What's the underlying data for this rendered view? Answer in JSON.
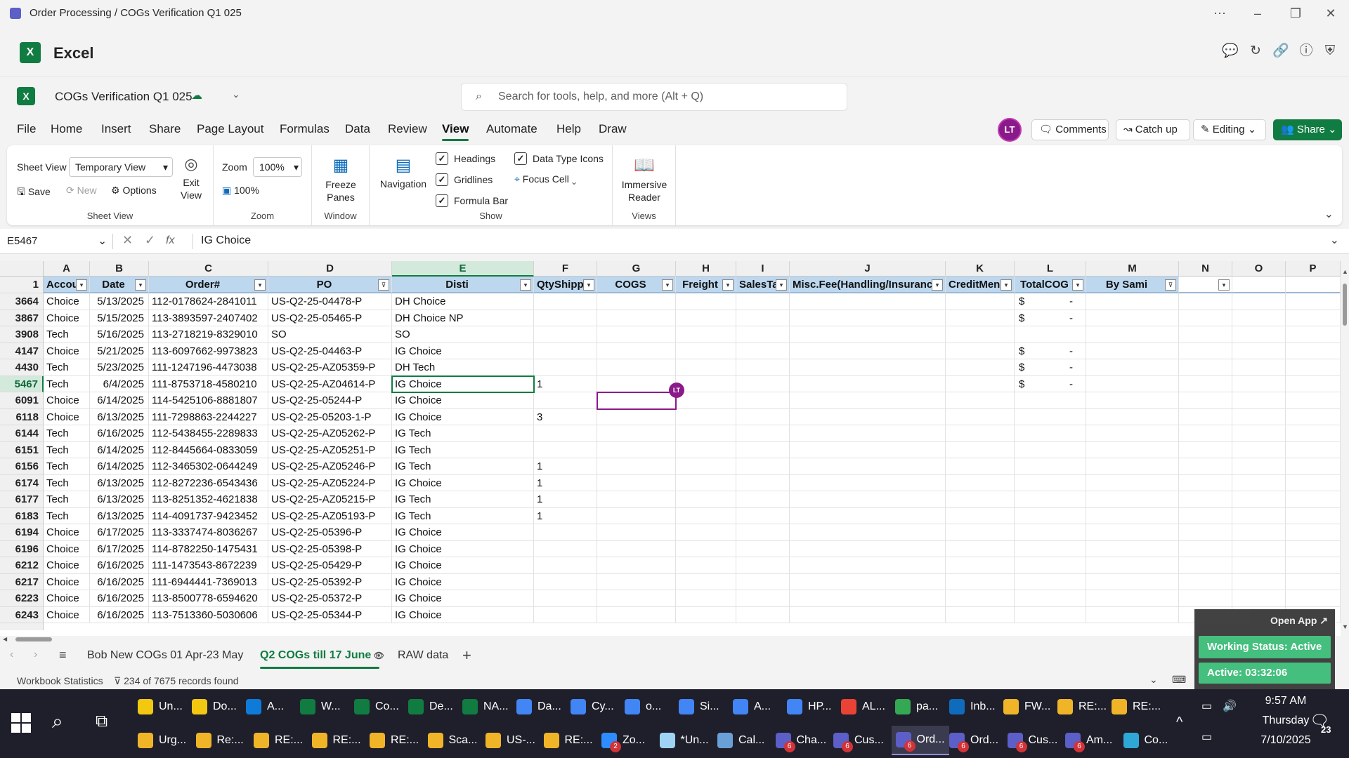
{
  "window": {
    "title": "Order Processing / COGs Verification Q1 025"
  },
  "app": {
    "name": "Excel"
  },
  "doc": {
    "name": "COGs Verification Q1 025"
  },
  "search": {
    "placeholder": "Search for tools, help, and more (Alt + Q)"
  },
  "menu": {
    "items": [
      "File",
      "Home",
      "Insert",
      "Share",
      "Page Layout",
      "Formulas",
      "Data",
      "Review",
      "View",
      "Automate",
      "Help",
      "Draw"
    ],
    "active": "View"
  },
  "user": {
    "initials": "LT"
  },
  "actions": {
    "comments": "Comments",
    "catchup": "Catch up",
    "editing": "Editing",
    "share": "Share"
  },
  "ribbon": {
    "sheet_view": {
      "label": "Sheet View",
      "selected": "Temporary View",
      "save": "Save",
      "new": "New",
      "options": "Options",
      "exit": "Exit View",
      "group": "Sheet View"
    },
    "zoom": {
      "label": "Zoom",
      "value": "100%",
      "hundred": "100%",
      "group": "Zoom"
    },
    "window": {
      "freeze": "Freeze Panes",
      "group": "Window"
    },
    "show": {
      "navigation": "Navigation",
      "headings": "Headings",
      "gridlines": "Gridlines",
      "formula_bar": "Formula Bar",
      "data_type_icons": "Data Type Icons",
      "focus_cell": "Focus Cell",
      "group": "Show"
    },
    "views": {
      "immersive": "Immersive Reader",
      "group": "Views"
    }
  },
  "formula": {
    "namebox": "E5467",
    "fx": "fx",
    "content": "IG Choice"
  },
  "grid": {
    "columns": [
      "A",
      "B",
      "C",
      "D",
      "E",
      "F",
      "G",
      "H",
      "I",
      "J",
      "K",
      "L",
      "M",
      "N",
      "O",
      "P"
    ],
    "selected_column": "E",
    "header_row_num": "1",
    "headers": [
      "Accou",
      "Date",
      "Order#",
      "PO",
      "Disti",
      "QtyShipp",
      "COGS",
      "Freight",
      "SalesTa",
      "Misc.Fee(Handling/Insuranc",
      "CreditMen",
      "TotalCOG",
      "By Sami",
      "",
      "",
      ""
    ],
    "rows": [
      {
        "num": "3664",
        "a": "Choice",
        "b": "5/13/2025",
        "c": "112-0178624-2841011",
        "d": "US-Q2-25-04478-P",
        "e": "DH Choice",
        "f": "",
        "l1": "$",
        "l2": "-"
      },
      {
        "num": "3867",
        "a": "Choice",
        "b": "5/15/2025",
        "c": "113-3893597-2407402",
        "d": "US-Q2-25-05465-P",
        "e": "DH Choice NP",
        "f": "",
        "l1": "$",
        "l2": "-"
      },
      {
        "num": "3908",
        "a": "Tech",
        "b": "5/16/2025",
        "c": "113-2718219-8329010",
        "d": "SO",
        "e": "SO",
        "f": "",
        "l1": "",
        "l2": ""
      },
      {
        "num": "4147",
        "a": "Choice",
        "b": "5/21/2025",
        "c": "113-6097662-9973823",
        "d": "US-Q2-25-04463-P",
        "e": "IG Choice",
        "f": "",
        "l1": "$",
        "l2": "-"
      },
      {
        "num": "4430",
        "a": "Tech",
        "b": "5/23/2025",
        "c": "111-1247196-4473038",
        "d": "US-Q2-25-AZ05359-P",
        "e": "DH Tech",
        "f": "",
        "l1": "$",
        "l2": "-"
      },
      {
        "num": "5467",
        "a": "Tech",
        "b": "6/4/2025",
        "c": "111-8753718-4580210",
        "d": "US-Q2-25-AZ04614-P",
        "e": "IG Choice",
        "f": "1",
        "l1": "$",
        "l2": "-"
      },
      {
        "num": "6091",
        "a": "Choice",
        "b": "6/14/2025",
        "c": "114-5425106-8881807",
        "d": "US-Q2-25-05244-P",
        "e": "IG Choice",
        "f": "",
        "l1": "",
        "l2": ""
      },
      {
        "num": "6118",
        "a": "Choice",
        "b": "6/13/2025",
        "c": "111-7298863-2244227",
        "d": "US-Q2-25-05203-1-P",
        "e": "IG Choice",
        "f": "3",
        "l1": "",
        "l2": ""
      },
      {
        "num": "6144",
        "a": "Tech",
        "b": "6/16/2025",
        "c": "112-5438455-2289833",
        "d": "US-Q2-25-AZ05262-P",
        "e": "IG Tech",
        "f": "",
        "l1": "",
        "l2": ""
      },
      {
        "num": "6151",
        "a": "Tech",
        "b": "6/14/2025",
        "c": "112-8445664-0833059",
        "d": "US-Q2-25-AZ05251-P",
        "e": "IG Tech",
        "f": "",
        "l1": "",
        "l2": ""
      },
      {
        "num": "6156",
        "a": "Tech",
        "b": "6/14/2025",
        "c": "112-3465302-0644249",
        "d": "US-Q2-25-AZ05246-P",
        "e": "IG Tech",
        "f": "1",
        "l1": "",
        "l2": ""
      },
      {
        "num": "6174",
        "a": "Tech",
        "b": "6/13/2025",
        "c": "112-8272236-6543436",
        "d": "US-Q2-25-AZ05224-P",
        "e": "IG Choice",
        "f": "1",
        "l1": "",
        "l2": ""
      },
      {
        "num": "6177",
        "a": "Tech",
        "b": "6/13/2025",
        "c": "113-8251352-4621838",
        "d": "US-Q2-25-AZ05215-P",
        "e": "IG Tech",
        "f": "1",
        "l1": "",
        "l2": ""
      },
      {
        "num": "6183",
        "a": "Tech",
        "b": "6/13/2025",
        "c": "114-4091737-9423452",
        "d": "US-Q2-25-AZ05193-P",
        "e": "IG Tech",
        "f": "1",
        "l1": "",
        "l2": ""
      },
      {
        "num": "6194",
        "a": "Choice",
        "b": "6/17/2025",
        "c": "113-3337474-8036267",
        "d": "US-Q2-25-05396-P",
        "e": "IG Choice",
        "f": "",
        "l1": "",
        "l2": ""
      },
      {
        "num": "6196",
        "a": "Choice",
        "b": "6/17/2025",
        "c": "114-8782250-1475431",
        "d": "US-Q2-25-05398-P",
        "e": "IG Choice",
        "f": "",
        "l1": "",
        "l2": ""
      },
      {
        "num": "6212",
        "a": "Choice",
        "b": "6/16/2025",
        "c": "111-1473543-8672239",
        "d": "US-Q2-25-05429-P",
        "e": "IG Choice",
        "f": "",
        "l1": "",
        "l2": ""
      },
      {
        "num": "6217",
        "a": "Choice",
        "b": "6/16/2025",
        "c": "111-6944441-7369013",
        "d": "US-Q2-25-05392-P",
        "e": "IG Choice",
        "f": "",
        "l1": "",
        "l2": ""
      },
      {
        "num": "6223",
        "a": "Choice",
        "b": "6/16/2025",
        "c": "113-8500778-6594620",
        "d": "US-Q2-25-05372-P",
        "e": "IG Choice",
        "f": "",
        "l1": "",
        "l2": ""
      },
      {
        "num": "6243",
        "a": "Choice",
        "b": "6/16/2025",
        "c": "113-7513360-5030606",
        "d": "US-Q2-25-05344-P",
        "e": "IG Choice",
        "f": "",
        "l1": "",
        "l2": ""
      }
    ]
  },
  "sheets": {
    "tabs": [
      "Bob New COGs 01 Apr-23 May",
      "Q2 COGs till 17 June",
      "RAW data"
    ],
    "active": "Q2 COGs till 17 June"
  },
  "status": {
    "workbook_stats": "Workbook Statistics",
    "filter": "234 of 7675 records found"
  },
  "widget": {
    "open_app": "Open App ↗",
    "working_status": "Working Status: Active",
    "active_time": "Active: 03:32:06"
  },
  "taskbar": {
    "top": [
      {
        "label": "Un...",
        "color": "#f2c811"
      },
      {
        "label": "Do...",
        "color": "#f2c811"
      },
      {
        "label": "A...",
        "color": "#0f7bd8"
      },
      {
        "label": "W...",
        "color": "#107c41"
      },
      {
        "label": "Co...",
        "color": "#107c41"
      },
      {
        "label": "De...",
        "color": "#107c41"
      },
      {
        "label": "NA...",
        "color": "#107c41"
      },
      {
        "label": "Da...",
        "color": "#4285f4"
      },
      {
        "label": "Cy...",
        "color": "#4285f4"
      },
      {
        "label": "o...",
        "color": "#4285f4"
      },
      {
        "label": "Si...",
        "color": "#4285f4"
      },
      {
        "label": "A...",
        "color": "#4285f4"
      },
      {
        "label": "HP...",
        "color": "#4285f4"
      },
      {
        "label": "AL...",
        "color": "#ea4335"
      },
      {
        "label": "pa...",
        "color": "#34a853"
      },
      {
        "label": "Inb...",
        "color": "#0f6cbd"
      },
      {
        "label": "FW...",
        "color": "#f0b429"
      },
      {
        "label": "RE:...",
        "color": "#f0b429"
      },
      {
        "label": "RE:...",
        "color": "#f0b429"
      }
    ],
    "bottom": [
      {
        "label": "Urg...",
        "color": "#f0b429"
      },
      {
        "label": "Re:...",
        "color": "#f0b429"
      },
      {
        "label": "RE:...",
        "color": "#f0b429"
      },
      {
        "label": "RE:...",
        "color": "#f0b429"
      },
      {
        "label": "RE:...",
        "color": "#f0b429"
      },
      {
        "label": "Sca...",
        "color": "#f0b429"
      },
      {
        "label": "US-...",
        "color": "#f0b429"
      },
      {
        "label": "RE:...",
        "color": "#f0b429"
      },
      {
        "label": "Zo...",
        "color": "#2d8cff",
        "badge": "2"
      },
      {
        "label": "*Un...",
        "color": "#9fd3f5"
      },
      {
        "label": "Cal...",
        "color": "#6aa0d8"
      },
      {
        "label": "Cha...",
        "color": "#5b5fc7",
        "badge": "6"
      },
      {
        "label": "Cus...",
        "color": "#5b5fc7",
        "badge": "6"
      },
      {
        "label": "Ord...",
        "color": "#5b5fc7",
        "badge": "6"
      },
      {
        "label": "Ord...",
        "color": "#5b5fc7",
        "badge": "6"
      },
      {
        "label": "Cus...",
        "color": "#5b5fc7",
        "badge": "6"
      },
      {
        "label": "Am...",
        "color": "#5b5fc7",
        "badge": "6"
      },
      {
        "label": "Co...",
        "color": "#2fa8d8"
      }
    ],
    "time": "9:57 AM",
    "day": "Thursday",
    "date": "7/10/2025",
    "notif": "23"
  }
}
